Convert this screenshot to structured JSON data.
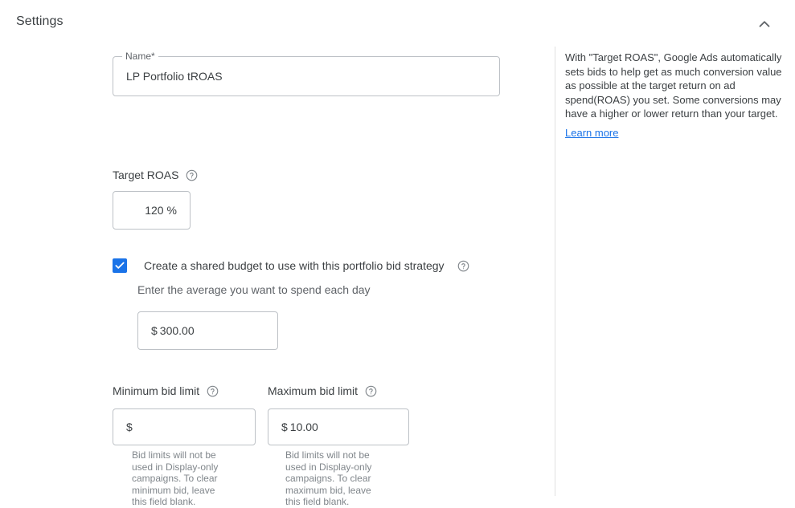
{
  "header": {
    "title": "Settings",
    "collapse_icon": "chevron-up-icon"
  },
  "form": {
    "name_field": {
      "label": "Name*",
      "value": "LP Portfolio tROAS"
    },
    "target_roas": {
      "label": "Target ROAS",
      "help_icon": "help-circle-icon",
      "value": "120",
      "suffix": "%"
    },
    "shared_budget": {
      "checkbox_label": "Create a shared budget to use with this portfolio bid strategy",
      "checkbox_checked": true,
      "help_icon": "help-circle-icon",
      "sub_label": "Enter the average you want to spend each day",
      "currency_prefix": "$",
      "value": "300.00"
    },
    "minimum_bid_limit": {
      "label": "Minimum bid limit",
      "help_icon": "help-circle-icon",
      "currency_prefix": "$",
      "value": "",
      "helper_text": "Bid limits will not be used in Display-only campaigns. To clear minimum bid, leave this field blank."
    },
    "maximum_bid_limit": {
      "label": "Maximum bid limit",
      "help_icon": "help-circle-icon",
      "currency_prefix": "$",
      "value": "10.00",
      "helper_text": "Bid limits will not be used in Display-only campaigns. To clear maximum bid, leave this field blank."
    }
  },
  "info_panel": {
    "description": "With \"Target ROAS\", Google Ads automatically sets bids to help get as much conversion value as possible at the target return on ad spend(ROAS) you set. Some conversions may have a higher or lower return than your target.",
    "learn_more_label": "Learn more"
  },
  "colors": {
    "accent": "#1a73e8",
    "text_primary": "#3c4043",
    "text_secondary": "#5f6368",
    "text_muted": "#80868b",
    "border": "#bdc1c6",
    "divider": "#e0e0e0"
  }
}
